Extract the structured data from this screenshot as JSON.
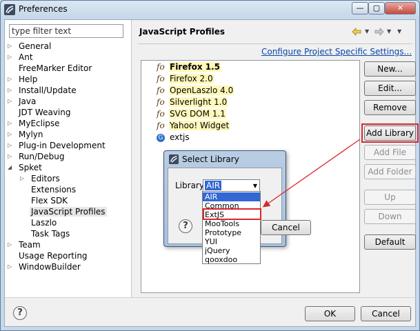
{
  "window": {
    "title": "Preferences"
  },
  "titlebar": {
    "min_icon": "minimize-icon",
    "max_icon": "maximize-icon",
    "close_icon": "close-icon"
  },
  "filter": {
    "placeholder": "type filter text"
  },
  "tree": [
    {
      "label": "General",
      "arrow": "collapsed"
    },
    {
      "label": "Ant",
      "arrow": "collapsed"
    },
    {
      "label": "FreeMarker Editor",
      "arrow": ""
    },
    {
      "label": "Help",
      "arrow": "collapsed"
    },
    {
      "label": "Install/Update",
      "arrow": "collapsed"
    },
    {
      "label": "Java",
      "arrow": "collapsed"
    },
    {
      "label": "JDT Weaving",
      "arrow": ""
    },
    {
      "label": "MyEclipse",
      "arrow": "collapsed"
    },
    {
      "label": "Mylyn",
      "arrow": "collapsed"
    },
    {
      "label": "Plug-in Development",
      "arrow": "collapsed"
    },
    {
      "label": "Run/Debug",
      "arrow": "collapsed"
    },
    {
      "label": "Spket",
      "arrow": "expanded"
    },
    {
      "label": "Editors",
      "arrow": "collapsed"
    },
    {
      "label": "Extensions",
      "arrow": ""
    },
    {
      "label": "Flex SDK",
      "arrow": ""
    },
    {
      "label": "JavaScript Profiles",
      "arrow": "",
      "selected": true
    },
    {
      "label": "Laszlo",
      "arrow": ""
    },
    {
      "label": "Task Tags",
      "arrow": ""
    },
    {
      "label": "Team",
      "arrow": "collapsed"
    },
    {
      "label": "Usage Reporting",
      "arrow": ""
    },
    {
      "label": "WindowBuilder",
      "arrow": "collapsed"
    }
  ],
  "page": {
    "title": "JavaScript Profiles",
    "configure_link": "Configure Project Specific Settings...",
    "history_icons": [
      "back-arrow-icon",
      "dropdown-arrow-icon",
      "forward-arrow-icon",
      "view-menu-icon"
    ]
  },
  "profiles": [
    {
      "icon": "fo",
      "name": "Firefox 1.5",
      "bold": true
    },
    {
      "icon": "fo",
      "name": "Firefox 2.0"
    },
    {
      "icon": "fo",
      "name": "OpenLaszlo 4.0"
    },
    {
      "icon": "fo",
      "name": "Silverlight 1.0"
    },
    {
      "icon": "fo",
      "name": "SVG DOM 1.1"
    },
    {
      "icon": "fo",
      "name": "Yahoo! Widget"
    },
    {
      "icon": "G",
      "name": "extjs"
    }
  ],
  "buttons": {
    "new": "New...",
    "edit": "Edit...",
    "remove": "Remove",
    "add_library": "Add Library",
    "add_file": "Add File",
    "add_folder": "Add Folder",
    "up": "Up",
    "down": "Down",
    "default": "Default",
    "ok": "OK",
    "cancel": "Cancel"
  },
  "dialog": {
    "title": "Select Library",
    "library_label": "Library",
    "selected": "AIR",
    "options": [
      "AIR",
      "Common",
      "ExtJS",
      "MooTools",
      "Prototype",
      "YUI",
      "jQuery",
      "qooxdoo"
    ],
    "cancel": "Cancel",
    "help": "?"
  },
  "help": "?",
  "colors": {
    "highlight": "#d8262d",
    "selection": "#3267d4",
    "link": "#0a46a8"
  }
}
